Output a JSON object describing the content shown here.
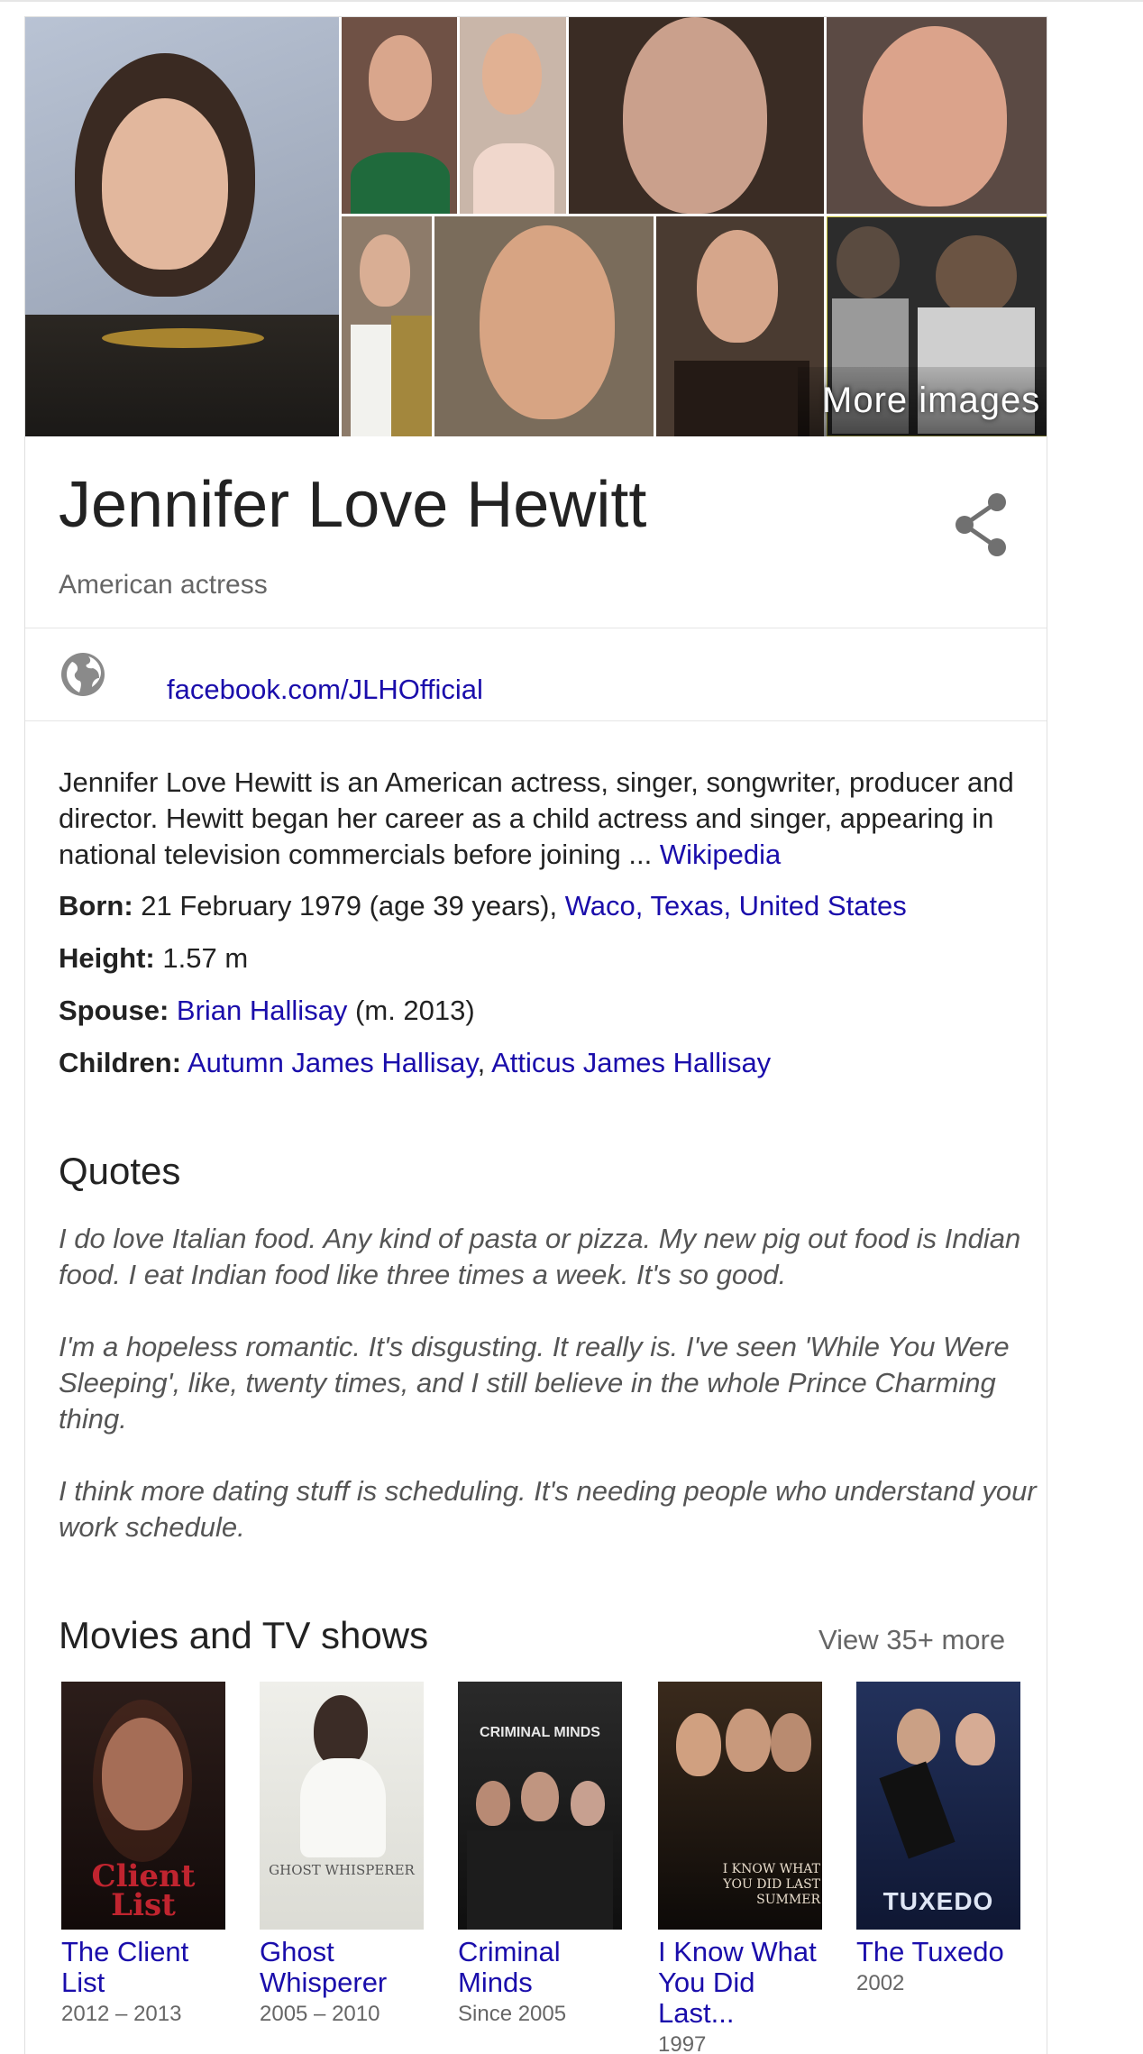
{
  "header": {
    "more_images": "More images",
    "name": "Jennifer Love Hewitt",
    "subtitle": "American actress"
  },
  "profile": {
    "website": "facebook.com/JLHOfficial"
  },
  "description": {
    "text": "Jennifer Love Hewitt is an American actress, singer, songwriter, producer and director. Hewitt began her career as a child actress and singer, appearing in national television commercials before joining ... ",
    "source": "Wikipedia"
  },
  "facts": {
    "born_label": "Born:",
    "born_value": " 21 February 1979 (age 39 years), ",
    "born_place": "Waco, Texas, United States",
    "height_label": "Height:",
    "height_value": " 1.57 m",
    "spouse_label": "Spouse:",
    "spouse_name": "Brian Hallisay",
    "spouse_extra": " (m. 2013)",
    "children_label": "Children:",
    "child1": "Autumn James Hallisay",
    "child_sep": ", ",
    "child2": "Atticus James Hallisay"
  },
  "quotes": {
    "heading": "Quotes",
    "items": [
      "I do love Italian food. Any kind of pasta or pizza. My new pig out food is Indian food. I eat Indian food like three times a week. It's so good.",
      "I'm a hopeless romantic. It's disgusting. It really is. I've seen 'While You Were Sleeping', like, twenty times, and I still believe in the whole Prince Charming thing.",
      "I think more dating stuff is scheduling. It's needing people who understand your work schedule."
    ]
  },
  "movies": {
    "heading": "Movies and TV shows",
    "view_more": "View 35+ more",
    "items": [
      {
        "title": "The Client List",
        "years": "2012 – 2013",
        "poster_text": "Client List"
      },
      {
        "title": "Ghost Whisperer",
        "years": "2005 – 2010",
        "poster_text": "GHOST WHISPERER"
      },
      {
        "title": "Criminal Minds",
        "years": "Since 2005",
        "poster_text": "CRIMINAL MINDS"
      },
      {
        "title": "I Know What You Did Last...",
        "years": "1997",
        "poster_text": "I KNOW WHAT YOU DID LAST SUMMER"
      },
      {
        "title": "The Tuxedo",
        "years": "2002",
        "poster_text": "TUXEDO"
      }
    ]
  },
  "colors": {
    "link": "#1a0dab",
    "muted": "#666666",
    "quote": "#555555",
    "border": "#e0e0e0"
  },
  "icons": [
    "share-icon",
    "globe-icon"
  ]
}
